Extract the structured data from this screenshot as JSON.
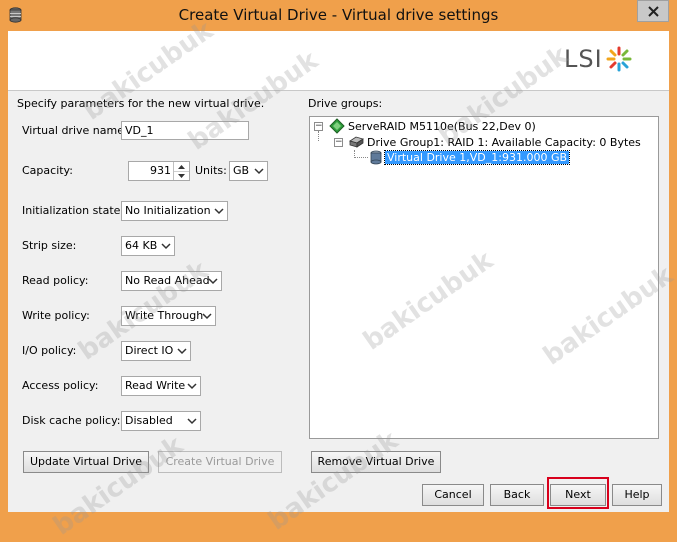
{
  "window": {
    "title": "Create Virtual Drive - Virtual drive settings"
  },
  "brand": {
    "logo_text": "LSI"
  },
  "form": {
    "intro": "Specify parameters for the new virtual drive.",
    "vd_name_label": "Virtual drive name:",
    "vd_name_value": "VD_1",
    "capacity_label": "Capacity:",
    "capacity_value": "931",
    "units_label": "Units:",
    "units_value": "GB",
    "init_state_label": "Initialization state:",
    "init_state_value": "No Initialization",
    "strip_size_label": "Strip size:",
    "strip_size_value": "64 KB",
    "read_policy_label": "Read policy:",
    "read_policy_value": "No Read Ahead",
    "write_policy_label": "Write policy:",
    "write_policy_value": "Write Through",
    "io_policy_label": "I/O policy:",
    "io_policy_value": "Direct IO",
    "access_policy_label": "Access policy:",
    "access_policy_value": "Read Write",
    "disk_cache_label": "Disk cache policy:",
    "disk_cache_value": "Disabled"
  },
  "drive_groups": {
    "label": "Drive groups:",
    "controller": "ServeRAID M5110e(Bus 22,Dev 0)",
    "group": "Drive Group1: RAID 1: Available Capacity: 0 Bytes",
    "virtual_drive": "Virtual Drive 1,VD_1:931.000 GB"
  },
  "buttons": {
    "update": "Update Virtual Drive",
    "create": "Create Virtual Drive",
    "remove": "Remove Virtual Drive",
    "cancel": "Cancel",
    "back": "Back",
    "next": "Next",
    "help": "Help"
  },
  "watermark": {
    "text": "bakicubuk"
  },
  "colors": {
    "title_bar": "#f0a04b",
    "selection": "#3399ff",
    "highlight": "#d8001c"
  }
}
